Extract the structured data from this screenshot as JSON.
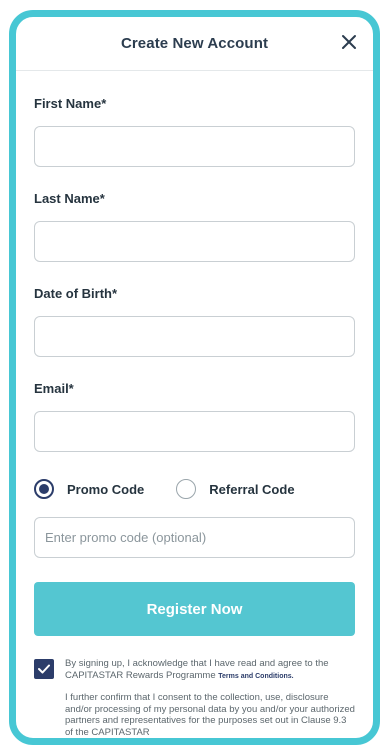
{
  "header": {
    "title": "Create New Account",
    "close_icon": "close-icon"
  },
  "form": {
    "first_name": {
      "label": "First Name*",
      "value": "",
      "placeholder": ""
    },
    "last_name": {
      "label": "Last Name*",
      "value": "",
      "placeholder": ""
    },
    "date_of_birth": {
      "label": "Date of Birth*",
      "value": "",
      "placeholder": ""
    },
    "email": {
      "label": "Email*",
      "value": "",
      "placeholder": ""
    },
    "code_type": {
      "options": [
        {
          "label": "Promo Code",
          "selected": true
        },
        {
          "label": "Referral Code",
          "selected": false
        }
      ]
    },
    "promo_code": {
      "value": "",
      "placeholder": "Enter promo code (optional)"
    },
    "register_label": "Register Now"
  },
  "consent": {
    "checked": true,
    "text": "By signing up, I acknowledge that I have read and agree to the CAPITASTAR Rewards Programme ",
    "terms_link": "Terms and Conditions.",
    "text2": "I further confirm that I consent to the collection, use, disclosure and/or processing of my personal data by you and/or your authorized partners and representatives for the purposes set out in Clause 9.3 of the CAPITASTAR"
  },
  "colors": {
    "accent": "#54c6d1",
    "frame": "#47c7d4",
    "primary_dark": "#2c3d6a"
  }
}
